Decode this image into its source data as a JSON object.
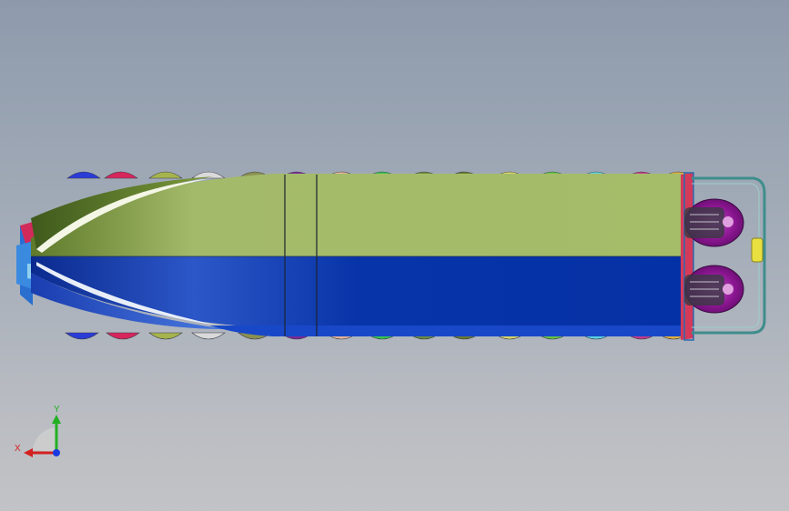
{
  "viewport": {
    "model": "boat-hull-with-engines",
    "background_top": "#8e9aac",
    "background_bottom": "#c2c3c6",
    "hull_top_color": "#a5bd69",
    "hull_bottom_color": "#0531a6",
    "engine_color": "#9a1fa0",
    "railing_color": "#3e8e8c",
    "bumper_colors": [
      "#2a3bd6",
      "#d7265c",
      "#a5b44d",
      "#d9d9d9",
      "#8a9050",
      "#7b2a99",
      "#e4b49a",
      "#38c44e",
      "#6c8a3f",
      "#6a7a2c",
      "#d9d46a",
      "#65c345",
      "#5cd4e3",
      "#c43a8a",
      "#e0b040",
      "#e04848",
      "#2fc0d0",
      "#5a3ac0",
      "#e06020",
      "#b03080"
    ]
  },
  "triad": {
    "x_label": "X",
    "y_label": "Y",
    "x_color": "#d42020",
    "y_color": "#22b022",
    "z_color": "#1a3ae0"
  }
}
